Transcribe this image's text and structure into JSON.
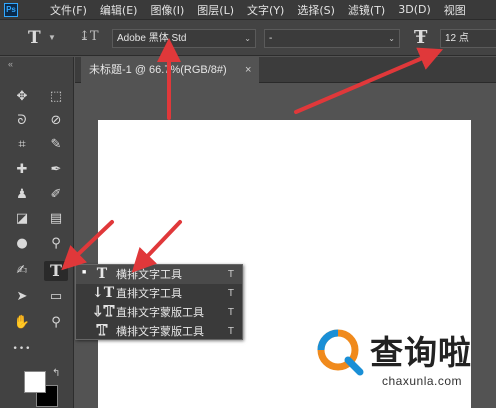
{
  "app": {
    "logo": "Ps"
  },
  "menu": [
    "文件(F)",
    "编辑(E)",
    "图像(I)",
    "图层(L)",
    "文字(Y)",
    "选择(S)",
    "滤镜(T)",
    "3D(D)",
    "视图"
  ],
  "options_bar": {
    "tool_icon": "T",
    "font_family": "Adobe 黑体 Std",
    "font_style": "-",
    "font_size": "12 点"
  },
  "toolbar": {
    "header": "«",
    "tools": [
      {
        "name": "move-icon",
        "glyph": "✥"
      },
      {
        "name": "marquee-icon",
        "glyph": "⬚"
      },
      {
        "name": "lasso-icon",
        "glyph": "ᘐ"
      },
      {
        "name": "quick-select-icon",
        "glyph": "⊘"
      },
      {
        "name": "crop-icon",
        "glyph": "⌗"
      },
      {
        "name": "eyedropper-icon",
        "glyph": "✎"
      },
      {
        "name": "healing-brush-icon",
        "glyph": "✚"
      },
      {
        "name": "brush-icon",
        "glyph": "✒"
      },
      {
        "name": "stamp-icon",
        "glyph": "♟"
      },
      {
        "name": "history-brush-icon",
        "glyph": "✐"
      },
      {
        "name": "eraser-icon",
        "glyph": "◪"
      },
      {
        "name": "gradient-icon",
        "glyph": "▤"
      },
      {
        "name": "blur-icon",
        "glyph": "●"
      },
      {
        "name": "dodge-icon",
        "glyph": "⚲"
      },
      {
        "name": "pen-icon",
        "glyph": "✍"
      },
      {
        "name": "type-icon",
        "glyph": "T"
      },
      {
        "name": "path-select-icon",
        "glyph": "➤"
      },
      {
        "name": "rectangle-icon",
        "glyph": "▭"
      },
      {
        "name": "hand-icon",
        "glyph": "✋"
      },
      {
        "name": "zoom-icon",
        "glyph": "⚲"
      },
      {
        "name": "more-icon",
        "glyph": "•••"
      }
    ]
  },
  "document": {
    "tab_title": "未标题-1 @ 66.7%(RGB/8#)",
    "close": "×"
  },
  "flyout": {
    "items": [
      {
        "icon": "T",
        "label": "横排文字工具",
        "key": "T",
        "selected": true
      },
      {
        "icon": "↓T",
        "label": "直排文字工具",
        "key": "T",
        "selected": false
      },
      {
        "icon": "↓T",
        "label": "直排文字蒙版工具",
        "key": "T",
        "selected": false
      },
      {
        "icon": "T",
        "label": "横排文字蒙版工具",
        "key": "T",
        "selected": false
      }
    ]
  },
  "watermark": {
    "title": "查询啦",
    "url": "chaxunla.com"
  },
  "colors": {
    "arrow": "#e0383a",
    "foreground": "#ffffff",
    "background": "#000000"
  }
}
